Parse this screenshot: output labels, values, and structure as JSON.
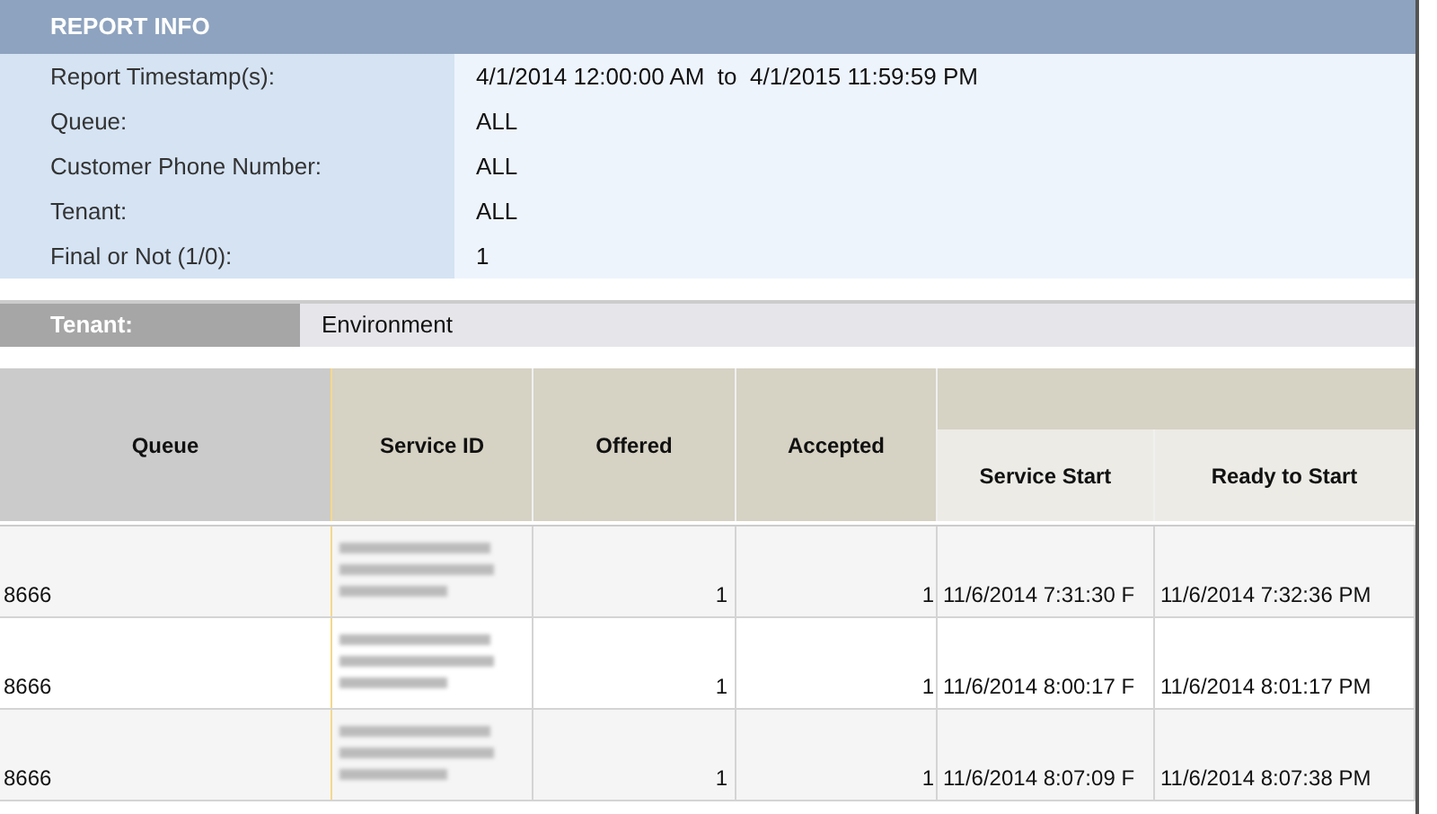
{
  "report_info": {
    "title": "REPORT INFO",
    "rows": [
      {
        "label": "Report Timestamp(s):",
        "value": "4/1/2014 12:00:00 AM  to  4/1/2015 11:59:59 PM"
      },
      {
        "label": "Queue:",
        "value": "ALL"
      },
      {
        "label": "Customer Phone Number:",
        "value": "ALL"
      },
      {
        "label": "Tenant:",
        "value": "ALL"
      },
      {
        "label": "Final or Not (1/0):",
        "value": "1"
      }
    ]
  },
  "tenant_bar": {
    "label": "Tenant:",
    "value": "Environment"
  },
  "table": {
    "columns": [
      "Queue",
      "Service ID",
      "Offered",
      "Accepted",
      "Service Start",
      "Ready to Start"
    ],
    "rows": [
      {
        "queue": "8666",
        "offered": "1",
        "accepted": "1",
        "service_start": "11/6/2014 7:31:30 F",
        "ready_to_start": "11/6/2014 7:32:36 PM"
      },
      {
        "queue": "8666",
        "offered": "1",
        "accepted": "1",
        "service_start": "11/6/2014 8:00:17 F",
        "ready_to_start": "11/6/2014 8:01:17 PM"
      },
      {
        "queue": "8666",
        "offered": "1",
        "accepted": "1",
        "service_start": "11/6/2014 8:07:09 F",
        "ready_to_start": "11/6/2014 8:07:38 PM"
      }
    ]
  }
}
